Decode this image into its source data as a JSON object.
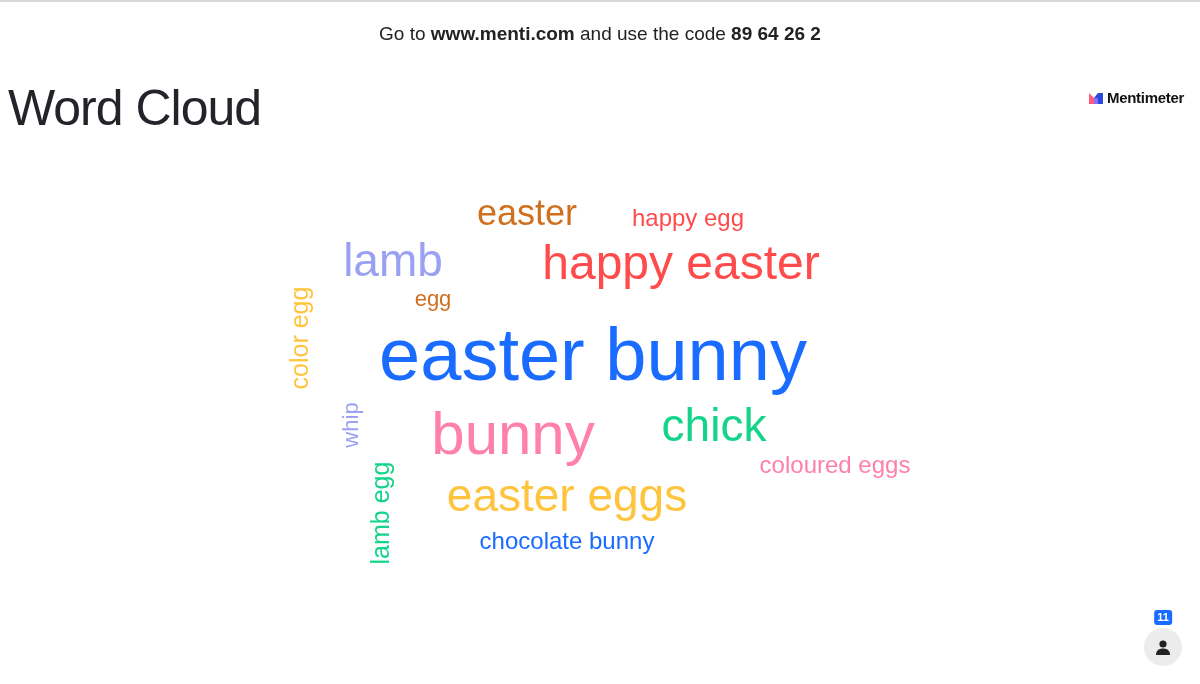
{
  "join_banner": "Go to **www.menti.com** and use the code **89 64 26 2**",
  "title": "Word Cloud",
  "logo": {
    "text": "Mentimeter"
  },
  "word_cloud": [
    {
      "text": "easter",
      "color": "#d0701f",
      "kind": "horizontal"
    },
    {
      "text": "happy egg",
      "color": "#ff4b4b",
      "kind": "horizontal"
    },
    {
      "text": "lamb",
      "color": "#9ba1f2",
      "kind": "horizontal"
    },
    {
      "text": "happy easter",
      "color": "#ff4b4b",
      "kind": "horizontal"
    },
    {
      "text": "egg",
      "color": "#d0701f",
      "kind": "horizontal"
    },
    {
      "text": "color egg",
      "color": "#ffc43d",
      "kind": "vertical"
    },
    {
      "text": "easter bunny",
      "color": "#196cff",
      "kind": "horizontal"
    },
    {
      "text": "whip",
      "color": "#9ba1f2",
      "kind": "vertical"
    },
    {
      "text": "bunny",
      "color": "#ff80a8",
      "kind": "horizontal"
    },
    {
      "text": "chick",
      "color": "#14d48c",
      "kind": "horizontal"
    },
    {
      "text": "coloured eggs",
      "color": "#ff80a8",
      "kind": "horizontal"
    },
    {
      "text": "lamb egg",
      "color": "#14d48c",
      "kind": "vertical"
    },
    {
      "text": "easter eggs",
      "color": "#ffc43d",
      "kind": "horizontal"
    },
    {
      "text": "chocolate bunny",
      "color": "#196cff",
      "kind": "horizontal"
    }
  ],
  "participants": {
    "count": "11"
  }
}
